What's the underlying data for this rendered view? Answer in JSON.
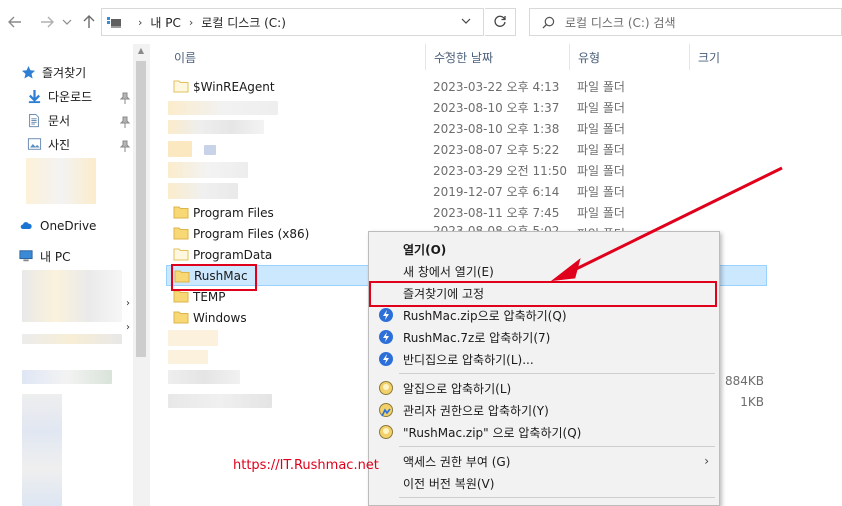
{
  "address": {
    "crumbs": [
      "내 PC",
      "로컬 디스크 (C:)"
    ],
    "search_placeholder": "로컬 디스크 (C:) 검색"
  },
  "nav": {
    "quick_access": "즐겨찾기",
    "items": [
      {
        "label": "다운로드",
        "icon": "download-icon"
      },
      {
        "label": "문서",
        "icon": "document-icon"
      },
      {
        "label": "사진",
        "icon": "pictures-icon"
      }
    ],
    "onedrive": "OneDrive",
    "this_pc": "내 PC"
  },
  "columns": {
    "name": "이름",
    "date": "수정한 날짜",
    "type": "유형",
    "size": "크기"
  },
  "files": [
    {
      "name": "$WinREAgent",
      "date": "2023-03-22 오후 4:13",
      "type": "파일 폴더",
      "size": ""
    },
    {
      "name": "",
      "date": "2023-08-10 오후 1:37",
      "type": "파일 폴더",
      "size": ""
    },
    {
      "name": "",
      "date": "2023-08-10 오후 1:38",
      "type": "파일 폴더",
      "size": ""
    },
    {
      "name": "",
      "date": "2023-08-07 오후 5:22",
      "type": "파일 폴더",
      "size": ""
    },
    {
      "name": "",
      "date": "2023-03-29 오전 11:50",
      "type": "파일 폴더",
      "size": ""
    },
    {
      "name": "",
      "date": "2019-12-07 오후 6:14",
      "type": "파일 폴더",
      "size": ""
    },
    {
      "name": "Program Files",
      "date": "2023-08-11 오후 7:45",
      "type": "파일 폴더",
      "size": ""
    },
    {
      "name": "Program Files (x86)",
      "date": "2023-08-08 오후 5:02",
      "type": "파일 폴더",
      "size": ""
    },
    {
      "name": "ProgramData",
      "date": "",
      "type": "",
      "size": ""
    },
    {
      "name": "RushMac",
      "date": "",
      "type": "",
      "size": ""
    },
    {
      "name": "TEMP",
      "date": "",
      "type": "",
      "size": ""
    },
    {
      "name": "Windows",
      "date": "",
      "type": "",
      "size": ""
    }
  ],
  "extra_sizes": [
    "884KB",
    "1KB"
  ],
  "context_menu": {
    "items": [
      {
        "label": "열기(O)",
        "bold": true,
        "icon": ""
      },
      {
        "label": "새 창에서 열기(E)",
        "bold": false,
        "icon": ""
      },
      {
        "label": "즐겨찾기에 고정",
        "bold": false,
        "icon": ""
      },
      {
        "label": "RushMac.zip으로 압축하기(Q)",
        "bold": false,
        "icon": "bandizip-icon"
      },
      {
        "label": "RushMac.7z로 압축하기(7)",
        "bold": false,
        "icon": "bandizip-icon"
      },
      {
        "label": "반디집으로 압축하기(L)...",
        "bold": false,
        "icon": "bandizip-icon"
      },
      {
        "label": "알집으로 압축하기(L)",
        "bold": false,
        "icon": "alzip-icon"
      },
      {
        "label": "관리자 권한으로 압축하기(Y)",
        "bold": false,
        "icon": "alzip-admin-icon"
      },
      {
        "label": "\"RushMac.zip\" 으로 압축하기(Q)",
        "bold": false,
        "icon": "alzip-icon"
      },
      {
        "label": "액세스 권한 부여 (G)",
        "bold": false,
        "icon": ""
      },
      {
        "label": "이전 버전 복원(V)",
        "bold": false,
        "icon": ""
      }
    ]
  },
  "watermark": "https://IT.Rushmac.net",
  "colors": {
    "highlight": "#e0001b",
    "selection": "#cce8ff",
    "folder": "#f8d775"
  }
}
